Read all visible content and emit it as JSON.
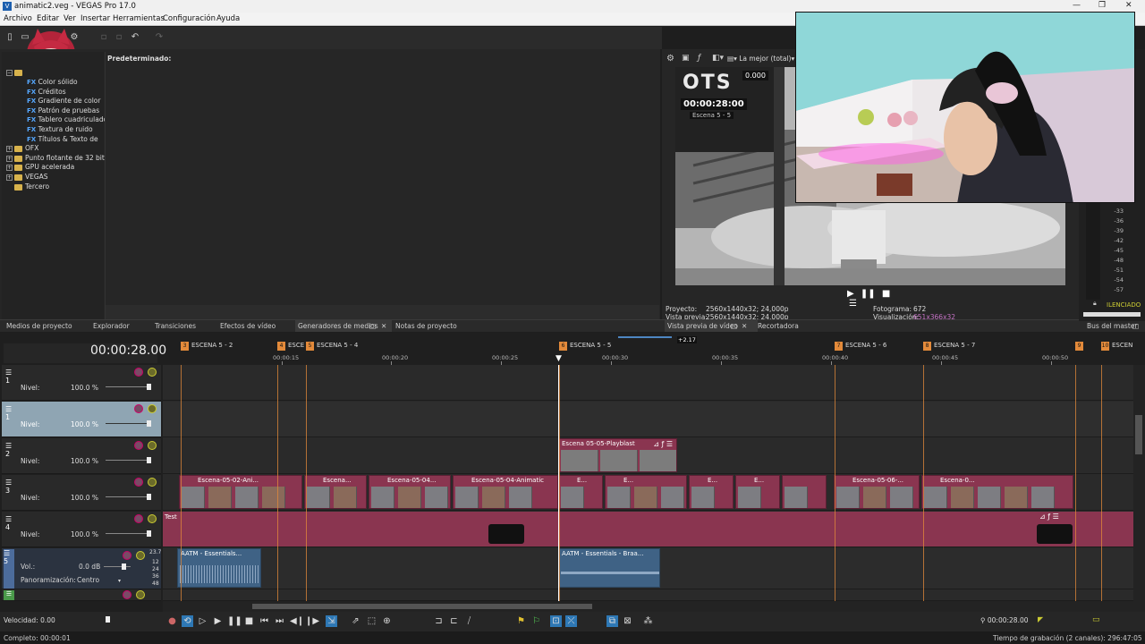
{
  "window": {
    "title": "animatic2.veg - VEGAS Pro 17.0"
  },
  "menu": [
    "Archivo",
    "Editar",
    "Ver",
    "Insertar",
    "Herramientas",
    "Configuración",
    "Ayuda"
  ],
  "media_generators": {
    "preset_title": "Predeterminado:",
    "tree": {
      "fx_items": [
        "Color sólido",
        "Créditos",
        "Gradiente de color",
        "Patrón de pruebas",
        "Tablero cuadriculado",
        "Textura de ruido",
        "Títulos & Texto de"
      ],
      "folders": [
        "OFX",
        "Punto flotante de 32 bits",
        "GPU acelerada",
        "VEGAS",
        "Tercero"
      ]
    }
  },
  "bottom_tabs": [
    "Medios de proyecto",
    "Explorador",
    "Transiciones",
    "Efectos de vídeo",
    "Generadores de medios",
    "Notas de proyecto"
  ],
  "preview": {
    "quality": "La mejor (total)",
    "overlay_logo": "OTS",
    "overlay_timecode": "00:00:28:00",
    "overlay_scene": "Escena 5 - 5",
    "overlay_value": "0.000",
    "proyecto_label": "Proyecto:",
    "proyecto_value": "2560x1440x32; 24,000p",
    "vista_label": "Vista previa:",
    "vista_value": "2560x1440x32; 24,000p",
    "fotograma_label": "Fotograma:",
    "fotograma_value": "672",
    "visualizacion_label": "Visualización:",
    "visualizacion_value": "651x366x32",
    "tabs": [
      "Vista previa de vídeo",
      "Recortadora"
    ],
    "master_tab": "Bus del master",
    "silenced": "ILENCIADO"
  },
  "meter": {
    "ticks": [
      "-33",
      "-36",
      "-39",
      "-42",
      "-45",
      "-48",
      "-51",
      "-54",
      "-57"
    ]
  },
  "timeline": {
    "timecode": "00:00:28.00",
    "ruler": [
      "00:00:15",
      "00:00:20",
      "00:00:25",
      "00:00:30",
      "00:00:35",
      "00:00:40",
      "00:00:45",
      "00:00:50"
    ],
    "markers": [
      {
        "n": "3",
        "label": "ESCENA 5 - 2"
      },
      {
        "n": "4",
        "label": "ESCE"
      },
      {
        "n": "5",
        "label": "ESCENA 5 - 4"
      },
      {
        "n": "6",
        "label": "ESCENA 5 - 5"
      },
      {
        "n": "7",
        "label": "ESCENA 5 - 6"
      },
      {
        "n": "8",
        "label": "ESCENA 5 - 7"
      },
      {
        "n": "9",
        "label": ""
      },
      {
        "n": "10",
        "label": "ESCEN"
      }
    ],
    "loop_region": "+2.17",
    "tracks": [
      {
        "num": "1",
        "level_label": "Nivel:",
        "level": "100.0 %"
      },
      {
        "num": "1",
        "level_label": "Nivel:",
        "level": "100.0 %"
      },
      {
        "num": "2",
        "level_label": "Nivel:",
        "level": "100.0 %"
      },
      {
        "num": "3",
        "level_label": "Nivel:",
        "level": "100.0 %"
      },
      {
        "num": "4",
        "level_label": "Nivel:",
        "level": "100.0 %"
      }
    ],
    "audio_track": {
      "num": "5",
      "vol_label": "Vol.:",
      "vol": "0.0 dB",
      "pan_label": "Panoramización:",
      "pan": "Centro",
      "peak": "23.7",
      "scale": [
        "12",
        "24",
        "36",
        "48"
      ]
    },
    "clips": {
      "playblast": "Escena 05-05-Playblast",
      "row3": [
        "Escena-05-02-Ani...",
        "Escena...",
        "Escena-05-04...",
        "Escena-05-04-Animatic",
        "E...",
        "E...",
        "E...",
        "E...",
        "Escena-05-06-...",
        "Escena-0..."
      ],
      "test": "Test",
      "audio1": "AATM - Essentials...",
      "audio2": "AATM - Essentials - Braa..."
    }
  },
  "transport": {
    "velocidad": "Velocidad: 0.00",
    "cursor_time": "00:00:28.00"
  },
  "status": {
    "left": "Completo: 00:00:01",
    "right": "Tiempo de grabación (2 canales): 296:47:05"
  }
}
